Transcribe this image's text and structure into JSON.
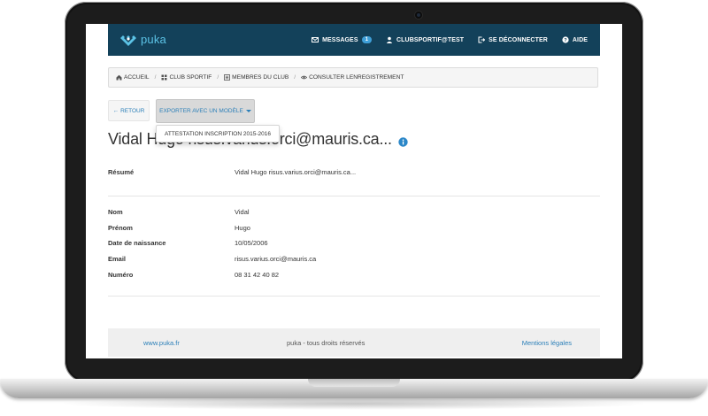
{
  "app": {
    "brand": "puka"
  },
  "nav": {
    "messages_label": "MESSAGES",
    "messages_count": "1",
    "user_label": "CLUBSPORTIF@TEST",
    "logout_label": "SE DÉCONNECTER",
    "help_label": "AIDE",
    "bg_color": "#13415a",
    "accent_color": "#5cc3e6"
  },
  "breadcrumb": [
    {
      "label": "ACCUEIL",
      "icon": "home-icon"
    },
    {
      "label": "CLUB SPORTIF",
      "icon": "grid-icon"
    },
    {
      "label": "MEMBRES DU CLUB",
      "icon": "list-icon"
    },
    {
      "label": "CONSULTER LENREGISTREMENT",
      "icon": "eye-icon"
    }
  ],
  "actions": {
    "back_label": "RETOUR",
    "export_label": "EXPORTER AVEC UN MODÈLE",
    "dropdown_items": [
      "ATTESTATION INSCRIPTION 2015-2016"
    ]
  },
  "record": {
    "title": "Vidal Hugo risus.varius.orci@mauris.ca...",
    "summary_label": "Résumé",
    "summary_value": "Vidal Hugo risus.varius.orci@mauris.ca...",
    "fields": [
      {
        "label": "Nom",
        "value": "Vidal"
      },
      {
        "label": "Prénom",
        "value": "Hugo"
      },
      {
        "label": "Date de naissance",
        "value": "10/05/2006"
      },
      {
        "label": "Email",
        "value": "risus.varius.orci@mauris.ca"
      },
      {
        "label": "Numéro",
        "value": "08 31 42 40 82"
      }
    ]
  },
  "footer": {
    "left_link": "www.puka.fr",
    "center_text": "puka - tous droits réservés",
    "right_link": "Mentions légales"
  },
  "colors": {
    "link": "#2b7fb8",
    "info": "#2b87c8"
  }
}
